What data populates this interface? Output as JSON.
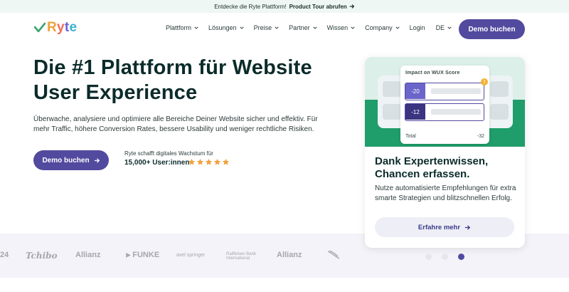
{
  "topbar": {
    "text": "Entdecke die Ryte Plattform!",
    "link_label": "Product Tour abrufen"
  },
  "brand": {
    "name": "Ryte",
    "colors": {
      "check_green": "#3aa56c",
      "r": "#f2a13a",
      "y": "#ef6b5a",
      "t": "#6a63d9",
      "e": "#3db3cf"
    }
  },
  "nav": {
    "items": [
      {
        "label": "Plattform",
        "has_dropdown": true
      },
      {
        "label": "Lösungen",
        "has_dropdown": true
      },
      {
        "label": "Preise",
        "has_dropdown": true
      },
      {
        "label": "Partner",
        "has_dropdown": true
      },
      {
        "label": "Wissen",
        "has_dropdown": true
      },
      {
        "label": "Company",
        "has_dropdown": true
      }
    ],
    "login_label": "Login",
    "language_label": "DE",
    "cta_label": "Demo buchen"
  },
  "hero": {
    "title_line1": "Die #1 Plattform für Website",
    "title_line2": "User Experience",
    "subtitle": "Überwache, analysiere und optimiere alle Bereiche Deiner Website sicher und effektiv. Für mehr Traffic, höhere Conversion Rates, bessere Usability und weniger rechtliche Risiken.",
    "cta_label": "Demo buchen",
    "growth_text": "Ryte schafft digitales Wachstum für",
    "users_count": "15,000+ User:innen",
    "rating_stars": 5,
    "star_color": "#f2a13a"
  },
  "card": {
    "widget_title": "Impact on WUX Score",
    "rows": [
      {
        "value": "-20"
      },
      {
        "value": "-12"
      }
    ],
    "total_label": "Total",
    "total_value": "-32",
    "badge": "!",
    "title_line1": "Dank Expertenwissen,",
    "title_line2": "Chancen erfassen.",
    "text": "Nutze automatisierte Empfehlungen für extra smarte Strategien und blitzschnellen Erfolg.",
    "cta_label": "Erfahre mehr"
  },
  "carousel": {
    "total": 3,
    "active_index": 2
  },
  "logos": [
    "24",
    "Tchibo",
    "Allianz",
    "FUNKE",
    "axel springer",
    "Raiffeisen Bank International",
    "Allianz"
  ],
  "colors": {
    "primary": "#524a9e",
    "accent_green": "#1f9d6a",
    "text_dark": "#0c2b2b"
  }
}
